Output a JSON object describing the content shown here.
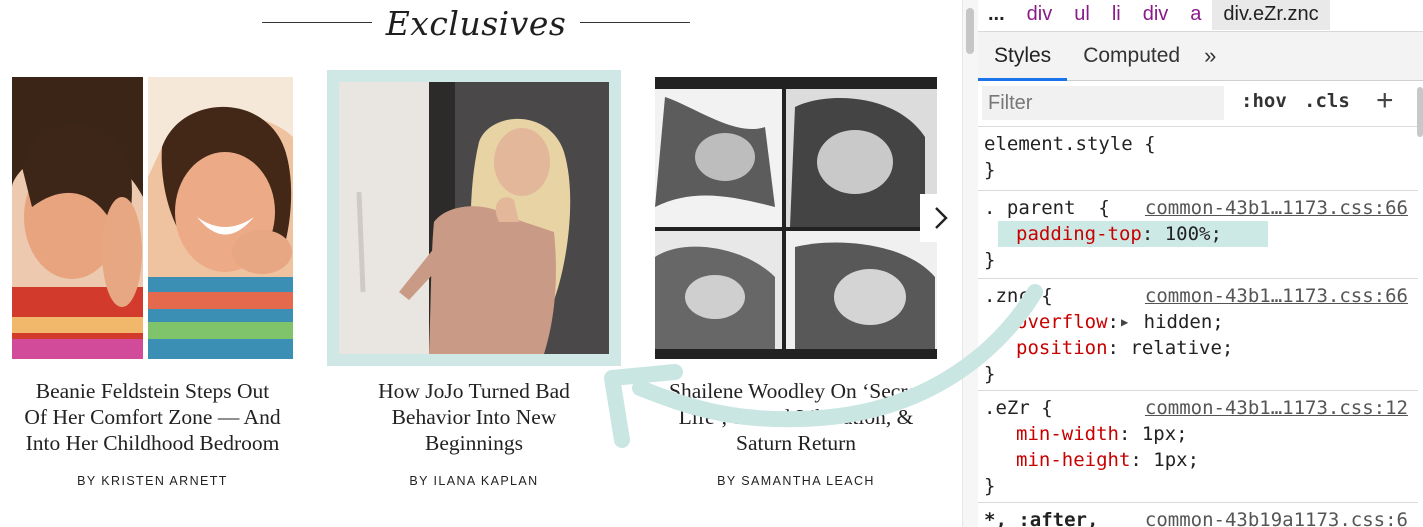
{
  "section": {
    "title": "Exclusives"
  },
  "cards": [
    {
      "title_lines": [
        "Beanie Feldstein Steps Out",
        "Of Her Comfort Zone — And",
        "Into Her Childhood Bedroom"
      ],
      "byline": "BY KRISTEN ARNETT"
    },
    {
      "title_lines": [
        "How JoJo Turned Bad",
        "Behavior Into New",
        "Beginnings"
      ],
      "byline": "BY ILANA KAPLAN"
    },
    {
      "title_lines": [
        "Shailene Woodley On ‘Secret",
        "Life’, Sexual Liberation, &",
        "Saturn Return"
      ],
      "byline": "BY SAMANTHA LEACH"
    }
  ],
  "devtools": {
    "breadcrumbs": [
      "...",
      "div",
      "ul",
      "li",
      "div",
      "a",
      "div.eZr.znc"
    ],
    "tabs": [
      "Styles",
      "Computed",
      "»"
    ],
    "filter_placeholder": "Filter",
    "filter_buttons": [
      ":hov",
      ".cls"
    ],
    "add_rule": "+",
    "rules": [
      {
        "selector": "element.style {",
        "source": "",
        "decls": [],
        "close": "}"
      },
      {
        "selector": ". parent  {",
        "source": "common-43b1…1173.css:66",
        "decls": [
          {
            "prop": "padding-top",
            "value": " 100%;"
          }
        ],
        "close": "}"
      },
      {
        "selector": ".znc {",
        "source": "common-43b1…1173.css:66",
        "decls": [
          {
            "prop": "overflow",
            "value": " hidden;"
          },
          {
            "prop": "position",
            "value": " relative;"
          }
        ],
        "close": "}"
      },
      {
        "selector": ".eZr {",
        "source": "common-43b1…1173.css:12",
        "decls": [
          {
            "prop": "min-width",
            "value": " 1px;"
          },
          {
            "prop": "min-height",
            "value": " 1px;"
          }
        ],
        "close": "}"
      },
      {
        "selector": "*, :after,",
        "source": "common-43b19a1173.css:6",
        "decls": [],
        "close": ""
      }
    ]
  },
  "colors": {
    "highlight": "#cde9e6",
    "arrow": "#c9e6e3",
    "prop": "#c80000",
    "crumb": "#8a1a8a",
    "tab_accent": "#1a73e8"
  },
  "icons": {
    "next": "chevron-right-icon",
    "more_tabs": "double-chevron-icon",
    "add": "plus-icon",
    "overflow_toggle": "triangle-right-icon"
  }
}
